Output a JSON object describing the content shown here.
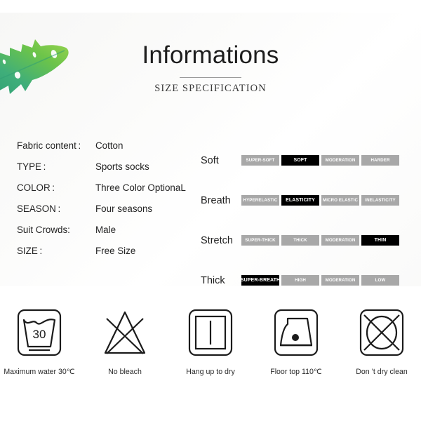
{
  "header": {
    "title": "Informations",
    "subtitle": "SIZE SPECIFICATION"
  },
  "decor": {
    "leaf_icon": "monstera-leaf-icon",
    "leaf_colors": [
      "#3fae7a",
      "#76c843",
      "#2f9e74",
      "#9ad44f"
    ]
  },
  "specs": [
    {
      "key": "Fabric content :",
      "value": "Cotton"
    },
    {
      "key": "TYPE :",
      "value": "Sports socks"
    },
    {
      "key": "COLOR :",
      "value": "Three Color OptionaL"
    },
    {
      "key": "SEASON :",
      "value": "Four seasons"
    },
    {
      "key": "Suit Crowds:",
      "value": "Male"
    },
    {
      "key": "SIZE :",
      "value": "Free Size"
    }
  ],
  "ratings": [
    {
      "label": "Soft",
      "cells": [
        "SUPER-SOFT",
        "SOFT",
        "MODERATION",
        "HARDER"
      ],
      "active_index": 1
    },
    {
      "label": "Breath",
      "cells": [
        "HYPERELASTIC",
        "ELASTICITY",
        "MICRO ELASTIC",
        "INELASTICITY"
      ],
      "active_index": 1
    },
    {
      "label": "Stretch",
      "cells": [
        "SUPER-THICK",
        "THICK",
        "MODERATION",
        "THIN"
      ],
      "active_index": 3
    },
    {
      "label": "Thick",
      "cells": [
        "SUPER-BREATH",
        "HIGH",
        "MODERATION",
        "LOW"
      ],
      "active_index": 0
    }
  ],
  "colors": {
    "scale_inactive": "#a8a8a8",
    "scale_active": "#000000",
    "text": "#1f1f1f"
  },
  "care": [
    {
      "icon": "wash-tub-30-icon",
      "caption": "Maximum water 30℃",
      "wash_temp": "30"
    },
    {
      "icon": "no-bleach-icon",
      "caption": "No bleach"
    },
    {
      "icon": "hang-dry-icon",
      "caption": "Hang up to dry"
    },
    {
      "icon": "iron-one-dot-icon",
      "caption": "Floor top 110℃"
    },
    {
      "icon": "no-dry-clean-icon",
      "caption": "Don ’t dry clean"
    }
  ]
}
